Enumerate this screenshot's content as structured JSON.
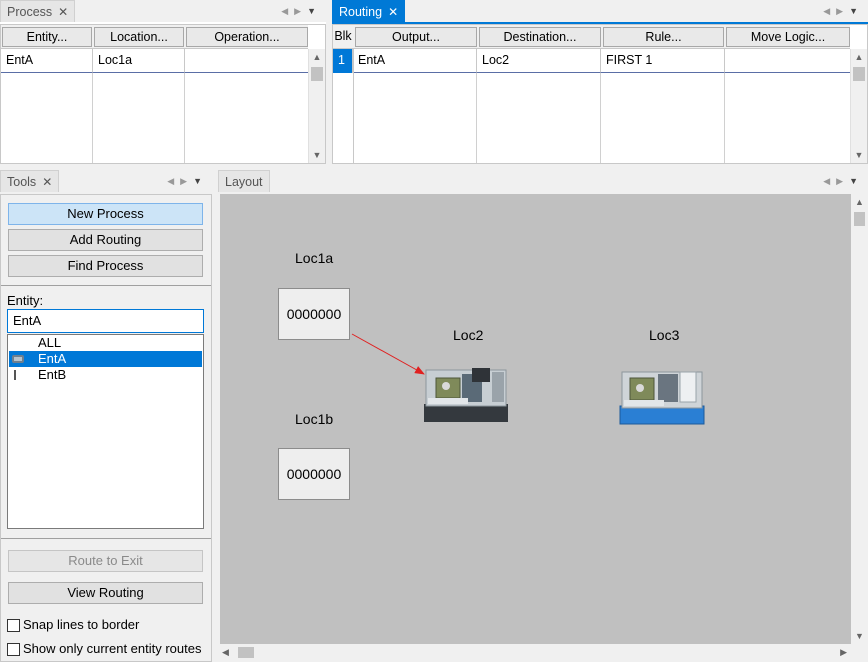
{
  "process_panel": {
    "tab": "Process",
    "columns": [
      "Entity...",
      "Location...",
      "Operation..."
    ],
    "rows": [
      {
        "entity": "EntA",
        "location": "Loc1a",
        "operation": ""
      }
    ]
  },
  "routing_panel": {
    "tab": "Routing",
    "columns": [
      "Blk",
      "Output...",
      "Destination...",
      "Rule...",
      "Move Logic..."
    ],
    "rows": [
      {
        "blk": "1",
        "output": "EntA",
        "destination": "Loc2",
        "rule": "FIRST 1",
        "move_logic": ""
      }
    ]
  },
  "tools_panel": {
    "tab": "Tools",
    "buttons": {
      "new_process": "New Process",
      "add_routing": "Add Routing",
      "find_process": "Find Process",
      "route_to_exit": "Route to Exit",
      "view_routing": "View Routing"
    },
    "entity_label": "Entity:",
    "entity_value": "EntA",
    "entity_list": [
      "ALL",
      "EntA",
      "EntB"
    ],
    "entity_selected": "EntA",
    "checkboxes": {
      "snap_lines": "Snap lines to border",
      "show_only_current": "Show only current entity routes"
    },
    "snap_checked": false,
    "show_only_checked": false
  },
  "layout_panel": {
    "tab": "Layout",
    "locations": [
      {
        "name": "Loc1a",
        "counter": "0000000"
      },
      {
        "name": "Loc1b",
        "counter": "0000000"
      },
      {
        "name": "Loc2"
      },
      {
        "name": "Loc3"
      }
    ]
  },
  "colors": {
    "accent": "#0079d6",
    "selection": "#0078d7",
    "canvas": "#c0c0c0",
    "route_arrow": "#e02020"
  },
  "icons": [
    "close-icon",
    "tab-arrow-left-icon",
    "tab-arrow-right-icon",
    "dropdown-icon",
    "cnc-lathe-icon",
    "entity-icon"
  ]
}
